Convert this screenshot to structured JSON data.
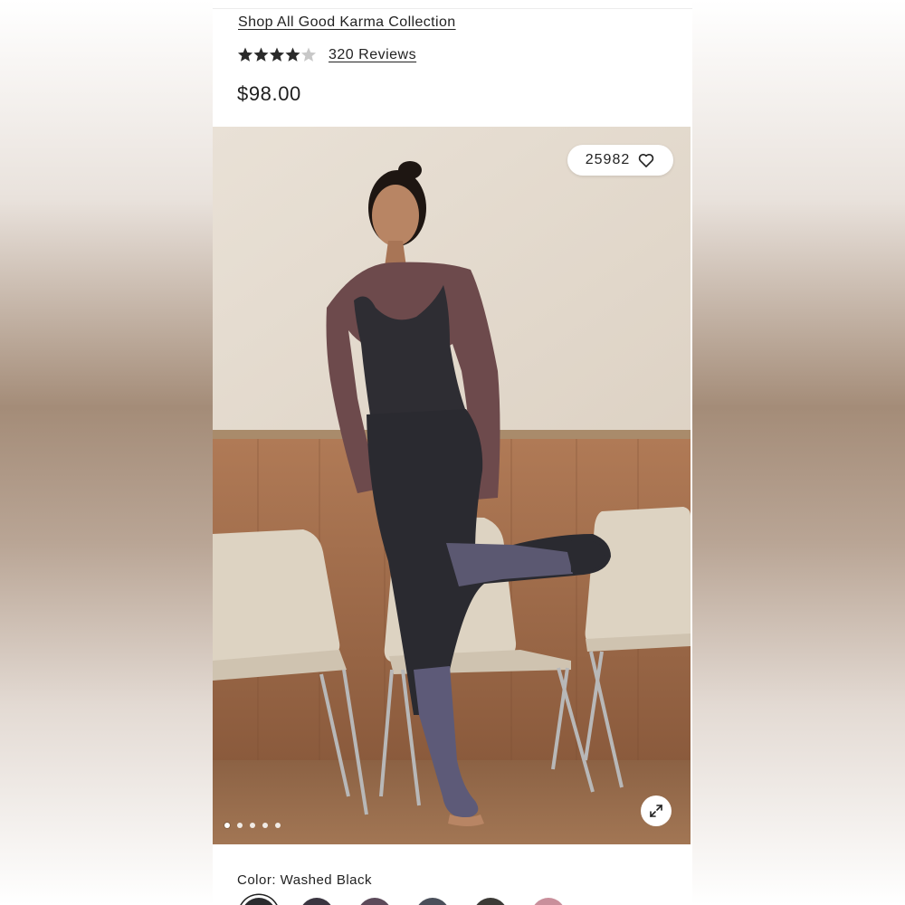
{
  "product": {
    "collection_link": "Shop All Good Karma Collection",
    "rating": 4,
    "rating_max": 5,
    "reviews_link": "320 Reviews",
    "price": "$98.00",
    "favorites_count": "25982",
    "color_label": "Color: Washed Black"
  },
  "gallery": {
    "image_count": 5,
    "active_index": 0
  },
  "swatches": [
    {
      "name": "washed-black",
      "color": "#2b2b2e",
      "selected": true
    },
    {
      "name": "swatch-2",
      "color": "#3a3540",
      "selected": false
    },
    {
      "name": "swatch-3",
      "color": "#5c4a5a",
      "selected": false
    },
    {
      "name": "swatch-4",
      "color": "#4a4f5a",
      "selected": false
    },
    {
      "name": "swatch-5",
      "color": "#3c3a36",
      "selected": false
    },
    {
      "name": "swatch-6",
      "color": "#c98f9b",
      "selected": false
    }
  ],
  "colors": {
    "star_filled": "#2a2a2a",
    "star_empty": "#c8c8c8",
    "text": "#222222"
  }
}
